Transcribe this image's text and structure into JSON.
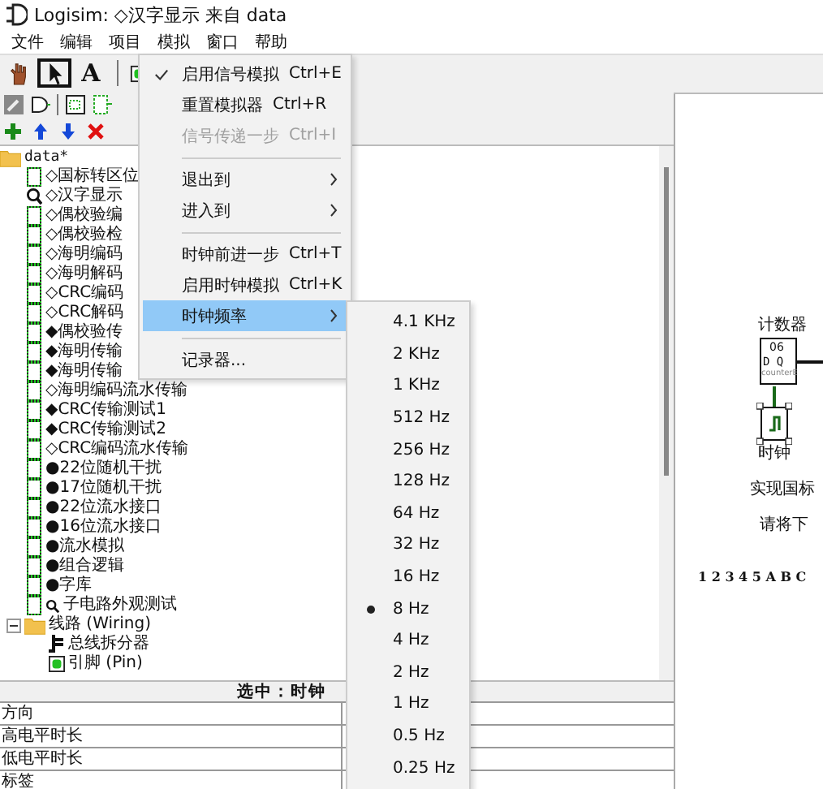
{
  "window": {
    "title": "Logisim: ◇汉字显示 来自 data"
  },
  "menu_bar": [
    {
      "label": "文件"
    },
    {
      "label": "编辑"
    },
    {
      "label": "项目"
    },
    {
      "label": "模拟"
    },
    {
      "label": "窗口"
    },
    {
      "label": "帮助"
    }
  ],
  "toolbar": {
    "tools": [
      {
        "kind": "hand",
        "selected": false
      },
      {
        "kind": "select",
        "selected": true
      },
      {
        "kind": "text",
        "label": "A",
        "selected": false
      }
    ]
  },
  "tree": [
    {
      "label": "data*",
      "kind": "folder",
      "children": [
        {
          "label": "◇国标转区位",
          "kind": "circuit"
        },
        {
          "label": "◇汉字显示",
          "kind": "current"
        },
        {
          "label": "◇偶校验编",
          "kind": "circuit"
        },
        {
          "label": "◇偶校验检",
          "kind": "circuit"
        },
        {
          "label": "◇海明编码",
          "kind": "circuit"
        },
        {
          "label": "◇海明解码",
          "kind": "circuit"
        },
        {
          "label": "◇CRC编码",
          "kind": "circuit"
        },
        {
          "label": "◇CRC解码",
          "kind": "circuit"
        },
        {
          "label": "◆偶校验传",
          "kind": "circuit"
        },
        {
          "label": "◆海明传输",
          "kind": "circuit"
        },
        {
          "label": "◆海明传输",
          "kind": "circuit"
        },
        {
          "label": "◇海明编码流水传输",
          "kind": "circuit"
        },
        {
          "label": "◆CRC传输测试1",
          "kind": "circuit"
        },
        {
          "label": "◆CRC传输测试2",
          "kind": "circuit"
        },
        {
          "label": "◇CRC编码流水传输",
          "kind": "circuit"
        },
        {
          "label": "●22位随机干扰",
          "kind": "circuit"
        },
        {
          "label": "●17位随机干扰",
          "kind": "circuit"
        },
        {
          "label": "●22位流水接口",
          "kind": "circuit"
        },
        {
          "label": "●16位流水接口",
          "kind": "circuit"
        },
        {
          "label": "●流水模拟",
          "kind": "circuit"
        },
        {
          "label": "●组合逻辑",
          "kind": "circuit"
        },
        {
          "label": "●字库",
          "kind": "circuit"
        },
        {
          "label": "子电路外观测试",
          "kind": "appearance"
        },
        {
          "label": "线路 (Wiring)",
          "kind": "folder",
          "expanded": true,
          "children": [
            {
              "label": "总线拆分器",
              "kind": "splitter"
            },
            {
              "label": "引脚 (Pin)",
              "kind": "pin"
            }
          ]
        }
      ]
    }
  ],
  "selection": {
    "label": "选中：时钟"
  },
  "properties": [
    {
      "name": "方向"
    },
    {
      "name": "高电平时长"
    },
    {
      "name": "低电平时长"
    },
    {
      "name": "标签"
    }
  ],
  "menu": {
    "items": [
      {
        "kind": "item",
        "label": "启用信号模拟",
        "shortcut": "Ctrl+E",
        "checked": true,
        "disabled": false,
        "highlighted": false
      },
      {
        "kind": "item",
        "label": "重置模拟器",
        "shortcut": "Ctrl+R",
        "checked": false,
        "disabled": false,
        "highlighted": false
      },
      {
        "kind": "item",
        "label": "信号传递一步",
        "shortcut": "Ctrl+I",
        "checked": false,
        "disabled": true,
        "highlighted": false
      },
      {
        "kind": "separator"
      },
      {
        "kind": "submenu",
        "label": "退出到",
        "checked": false,
        "disabled": false,
        "highlighted": false
      },
      {
        "kind": "submenu",
        "label": "进入到",
        "checked": false,
        "disabled": false,
        "highlighted": false
      },
      {
        "kind": "separator"
      },
      {
        "kind": "item",
        "label": "时钟前进一步",
        "shortcut": "Ctrl+T",
        "checked": false,
        "disabled": false,
        "highlighted": false
      },
      {
        "kind": "item",
        "label": "启用时钟模拟",
        "shortcut": "Ctrl+K",
        "checked": false,
        "disabled": false,
        "highlighted": false
      },
      {
        "kind": "submenu",
        "label": "时钟频率",
        "checked": false,
        "disabled": false,
        "highlighted": true
      },
      {
        "kind": "separator"
      },
      {
        "kind": "item",
        "label": "记录器...",
        "checked": false,
        "disabled": false,
        "highlighted": false
      }
    ]
  },
  "submenu": {
    "items": [
      {
        "label": "4.1 KHz",
        "selected": false
      },
      {
        "label": "2 KHz",
        "selected": false
      },
      {
        "label": "1 KHz",
        "selected": false
      },
      {
        "label": "512 Hz",
        "selected": false
      },
      {
        "label": "256 Hz",
        "selected": false
      },
      {
        "label": "128 Hz",
        "selected": false
      },
      {
        "label": "64 Hz",
        "selected": false
      },
      {
        "label": "32 Hz",
        "selected": false
      },
      {
        "label": "16 Hz",
        "selected": false
      },
      {
        "label": "8 Hz",
        "selected": true
      },
      {
        "label": "4 Hz",
        "selected": false
      },
      {
        "label": "2 Hz",
        "selected": false
      },
      {
        "label": "1 Hz",
        "selected": false
      },
      {
        "label": "0.5 Hz",
        "selected": false
      },
      {
        "label": "0.25 Hz",
        "selected": false
      }
    ]
  },
  "canvas": {
    "counter_label": "计数器",
    "counter_value": "06",
    "counter_pins": "D Q",
    "counter_name": "counterE",
    "clock_label": "时钟",
    "texts": [
      "实现国标",
      "请将下",
      "1 2 3 4 5 A B C"
    ]
  }
}
